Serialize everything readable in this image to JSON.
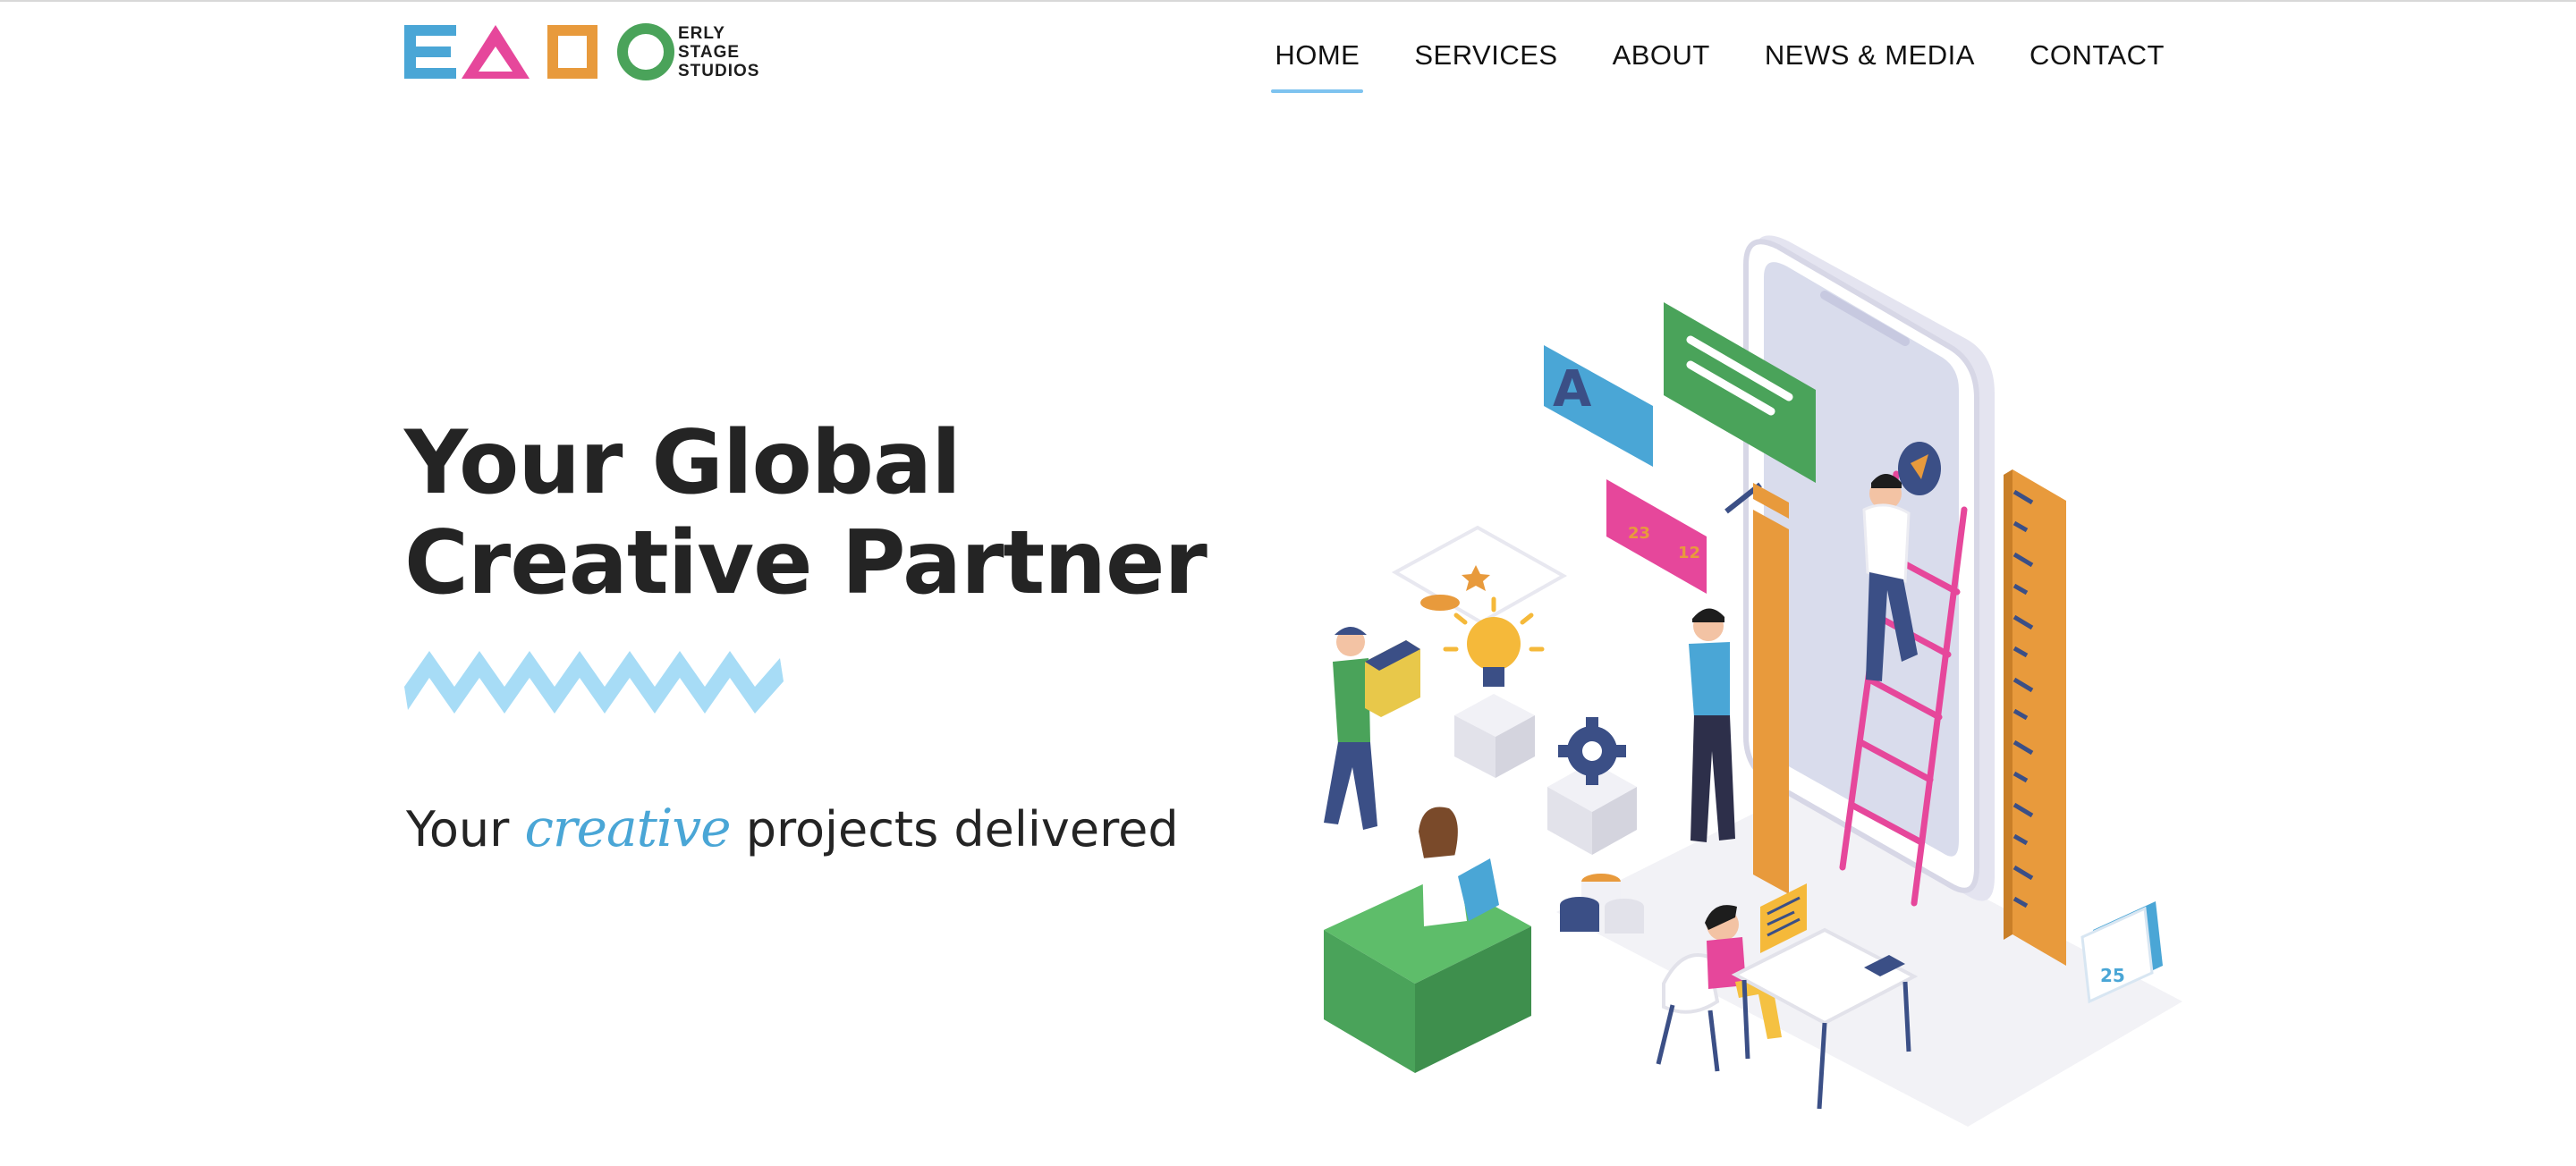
{
  "brand": {
    "logo_text_lines": [
      "ERLY",
      "STAGE",
      "STUDIOS"
    ],
    "colors": {
      "blue": "#4aa6d6",
      "pink": "#e6479b",
      "orange": "#e89a3c",
      "green": "#4aa35a",
      "nav_underline": "#7ec3ef",
      "zigzag": "#a7dcf6"
    }
  },
  "nav": {
    "items": [
      {
        "label": "HOME",
        "active": true
      },
      {
        "label": "SERVICES",
        "active": false
      },
      {
        "label": "ABOUT",
        "active": false
      },
      {
        "label": "NEWS & MEDIA",
        "active": false
      },
      {
        "label": "CONTACT",
        "active": false
      }
    ]
  },
  "hero": {
    "title_lines": [
      "Your Global",
      "Creative Partner"
    ],
    "tagline_prefix": "Your",
    "tagline_accent": "creative",
    "tagline_suffix": "projects delivered"
  },
  "illustration": {
    "icons": [
      "smartphone-icon",
      "chat-bubble-icon",
      "ladder-icon",
      "ruler-icon",
      "lightbulb-icon",
      "gear-icon",
      "calendar-icon"
    ],
    "card_numbers": [
      "23",
      "12"
    ],
    "calendar_day": "25"
  }
}
